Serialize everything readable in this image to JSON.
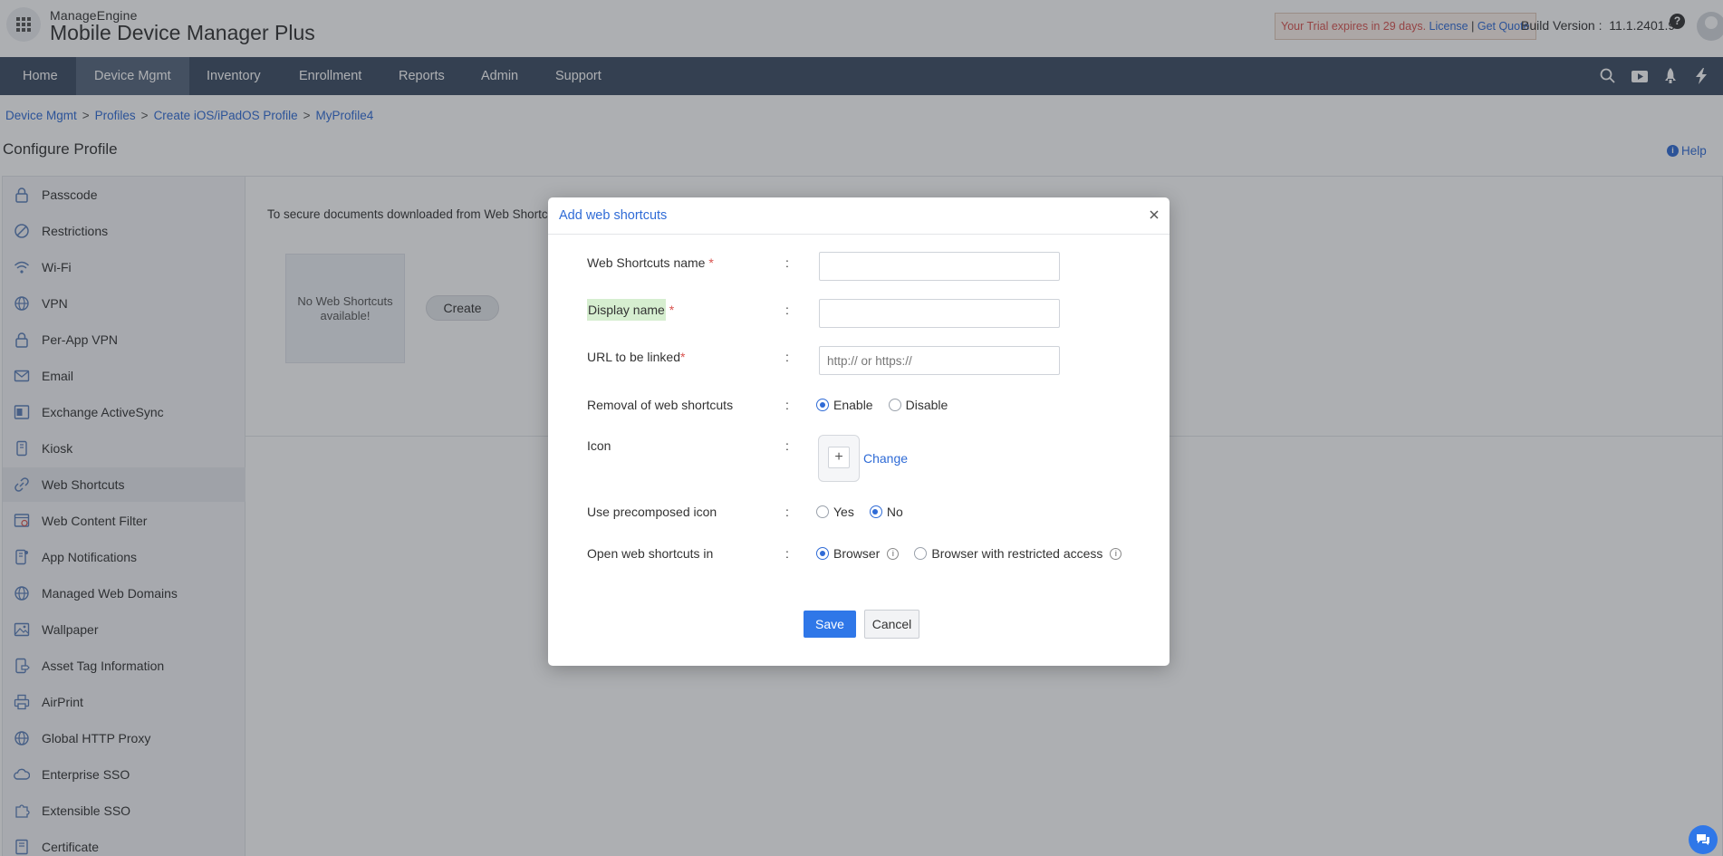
{
  "header": {
    "company": "ManageEngine",
    "product": "Mobile Device Manager Plus",
    "trial_text": "Your Trial expires in 29 days.",
    "license_link": "License",
    "link_separator": "|",
    "quote_link": "Get Quote",
    "build_label": "Build Version :",
    "build_version": "11.1.2401.9",
    "help_symbol": "?"
  },
  "nav": {
    "items": [
      "Home",
      "Device Mgmt",
      "Inventory",
      "Enrollment",
      "Reports",
      "Admin",
      "Support"
    ],
    "active": "Device Mgmt"
  },
  "breadcrumb": [
    "Device Mgmt",
    "Profiles",
    "Create iOS/iPadOS Profile",
    "MyProfile4"
  ],
  "breadcrumb_separator": ">",
  "page_title": "Configure Profile",
  "help_label": "Help",
  "sidebar": {
    "items": [
      {
        "label": "Passcode",
        "icon": "lock-icon"
      },
      {
        "label": "Restrictions",
        "icon": "restriction-icon"
      },
      {
        "label": "Wi-Fi",
        "icon": "wifi-icon"
      },
      {
        "label": "VPN",
        "icon": "globe-icon"
      },
      {
        "label": "Per-App VPN",
        "icon": "lock-icon"
      },
      {
        "label": "Email",
        "icon": "mail-icon"
      },
      {
        "label": "Exchange ActiveSync",
        "icon": "exchange-icon"
      },
      {
        "label": "Kiosk",
        "icon": "kiosk-icon"
      },
      {
        "label": "Web Shortcuts",
        "icon": "link-icon"
      },
      {
        "label": "Web Content Filter",
        "icon": "filter-icon"
      },
      {
        "label": "App Notifications",
        "icon": "notification-icon"
      },
      {
        "label": "Managed Web Domains",
        "icon": "globe-icon"
      },
      {
        "label": "Wallpaper",
        "icon": "image-icon"
      },
      {
        "label": "Asset Tag Information",
        "icon": "tag-icon"
      },
      {
        "label": "AirPrint",
        "icon": "printer-icon"
      },
      {
        "label": "Global HTTP Proxy",
        "icon": "globe-icon"
      },
      {
        "label": "Enterprise SSO",
        "icon": "cloud-icon"
      },
      {
        "label": "Extensible SSO",
        "icon": "puzzle-icon"
      },
      {
        "label": "Certificate",
        "icon": "certificate-icon"
      }
    ],
    "active": "Web Shortcuts"
  },
  "main": {
    "intro_text": "To secure documents downloaded from Web Shortcuts",
    "empty_text": "No Web Shortcuts available!",
    "create_label": "Create"
  },
  "modal": {
    "title": "Add web shortcuts",
    "colon": ":",
    "required_mark": "*",
    "fields": {
      "name_label": "Web Shortcuts name",
      "name_value": "",
      "display_label": "Display name",
      "display_value": "",
      "url_label": "URL to be linked",
      "url_value": "",
      "url_placeholder": "http:// or https://"
    },
    "removal": {
      "label": "Removal of web shortcuts",
      "options": [
        "Enable",
        "Disable"
      ],
      "selected": "Enable"
    },
    "icon": {
      "label": "Icon",
      "plus": "+",
      "change_label": "Change"
    },
    "precomposed": {
      "label": "Use precomposed icon",
      "options": [
        "Yes",
        "No"
      ],
      "selected": "No"
    },
    "open_in": {
      "label": "Open web shortcuts in",
      "options": [
        "Browser",
        "Browser with restricted access"
      ],
      "selected": "Browser",
      "info_symbol": "i"
    },
    "save_label": "Save",
    "cancel_label": "Cancel"
  },
  "colors": {
    "accent": "#2f6bd6",
    "nav_bg": "#3d4c63",
    "save_bg": "#2f77e8",
    "required": "#d9534f",
    "highlight": "#d6eed0"
  }
}
